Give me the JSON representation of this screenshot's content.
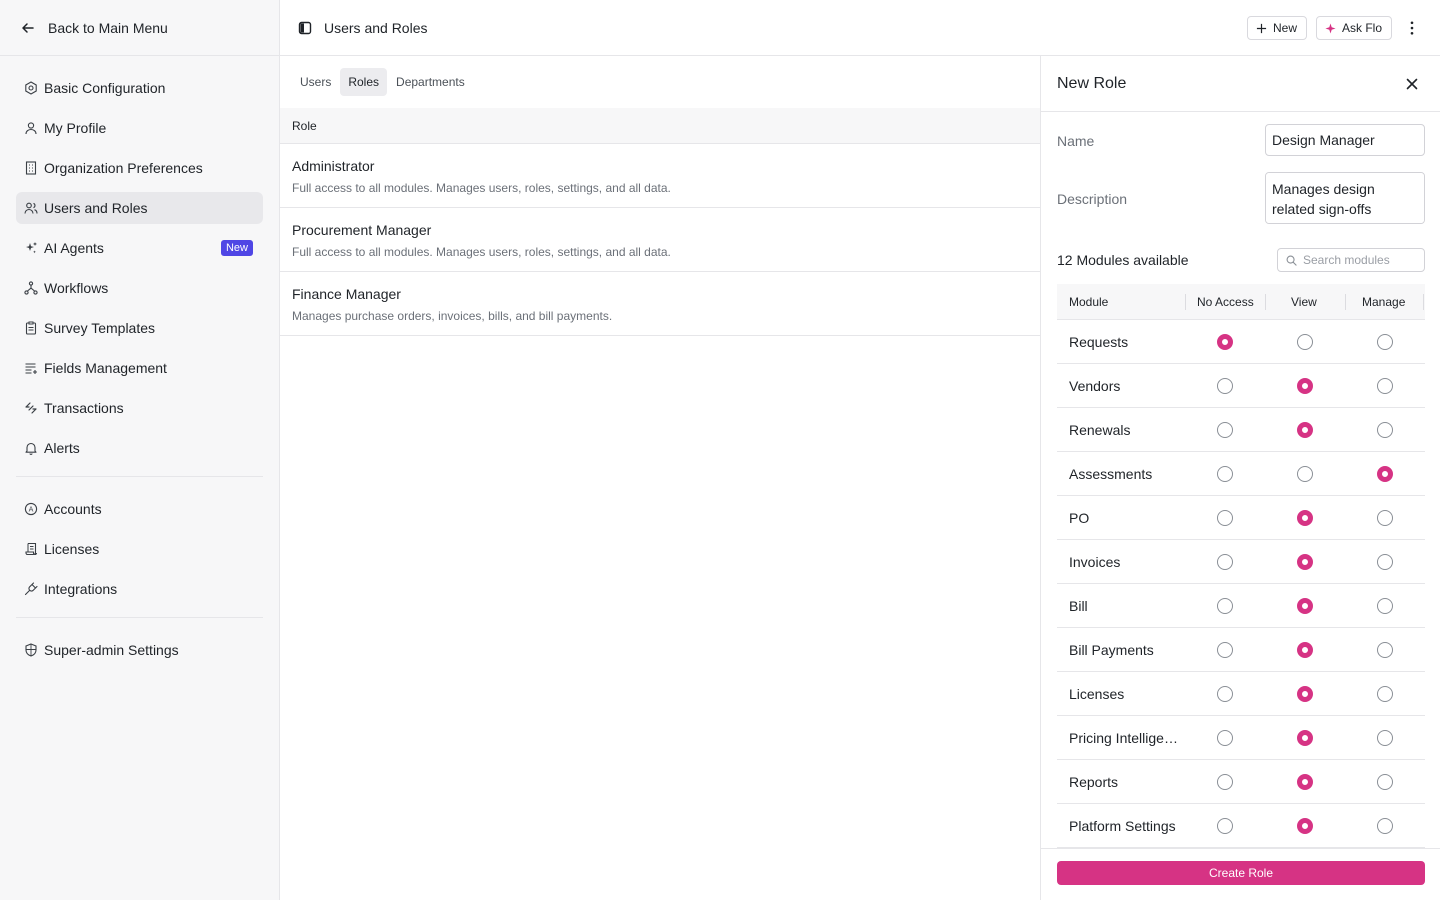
{
  "sidebar": {
    "back_label": "Back to Main Menu",
    "items": [
      {
        "label": "Basic Configuration",
        "icon": "settings-hex-icon"
      },
      {
        "label": "My Profile",
        "icon": "user-icon"
      },
      {
        "label": "Organization Preferences",
        "icon": "building-icon"
      },
      {
        "label": "Users and Roles",
        "icon": "users-icon",
        "active": true
      },
      {
        "label": "AI Agents",
        "icon": "sparkles-icon",
        "badge": "New"
      },
      {
        "label": "Workflows",
        "icon": "workflow-icon"
      },
      {
        "label": "Survey Templates",
        "icon": "clipboard-icon"
      },
      {
        "label": "Fields Management",
        "icon": "list-plus-icon"
      },
      {
        "label": "Transactions",
        "icon": "transactions-icon"
      },
      {
        "label": "Alerts",
        "icon": "bell-icon"
      },
      {
        "label": "Accounts",
        "icon": "account-icon"
      },
      {
        "label": "Licenses",
        "icon": "scroll-icon"
      },
      {
        "label": "Integrations",
        "icon": "plug-icon"
      },
      {
        "label": "Super-admin Settings",
        "icon": "shield-icon"
      }
    ]
  },
  "header": {
    "title": "Users and Roles",
    "new_label": "New",
    "ask_label": "Ask Flo"
  },
  "tabs": [
    "Users",
    "Roles",
    "Departments"
  ],
  "roles_table": {
    "column": "Role",
    "rows": [
      {
        "name": "Administrator",
        "description": "Full access to all modules. Manages users, roles, settings, and all data."
      },
      {
        "name": "Procurement Manager",
        "description": "Full access to all modules. Manages users, roles, settings, and all data."
      },
      {
        "name": "Finance Manager",
        "description": "Manages purchase orders, invoices, bills, and bill payments."
      }
    ]
  },
  "drawer": {
    "title": "New Role",
    "name_label": "Name",
    "name_value": "Design Manager",
    "description_label": "Description",
    "description_value": "Manages design related sign-offs",
    "modules_count": "12 Modules available",
    "search_placeholder": "Search modules",
    "columns": {
      "module": "Module",
      "no_access": "No Access",
      "view": "View",
      "manage": "Manage"
    },
    "modules": [
      {
        "name": "Requests",
        "access": "no_access"
      },
      {
        "name": "Vendors",
        "access": "view"
      },
      {
        "name": "Renewals",
        "access": "view"
      },
      {
        "name": "Assessments",
        "access": "manage"
      },
      {
        "name": "PO",
        "access": "view"
      },
      {
        "name": "Invoices",
        "access": "view"
      },
      {
        "name": "Bill",
        "access": "view"
      },
      {
        "name": "Bill Payments",
        "access": "view"
      },
      {
        "name": "Licenses",
        "access": "view"
      },
      {
        "name": "Pricing Intelligence",
        "access": "view"
      },
      {
        "name": "Reports",
        "access": "view"
      },
      {
        "name": "Platform Settings",
        "access": "view"
      }
    ],
    "create_label": "Create Role"
  },
  "colors": {
    "accent": "#d63384",
    "badge": "#4f46e5"
  }
}
